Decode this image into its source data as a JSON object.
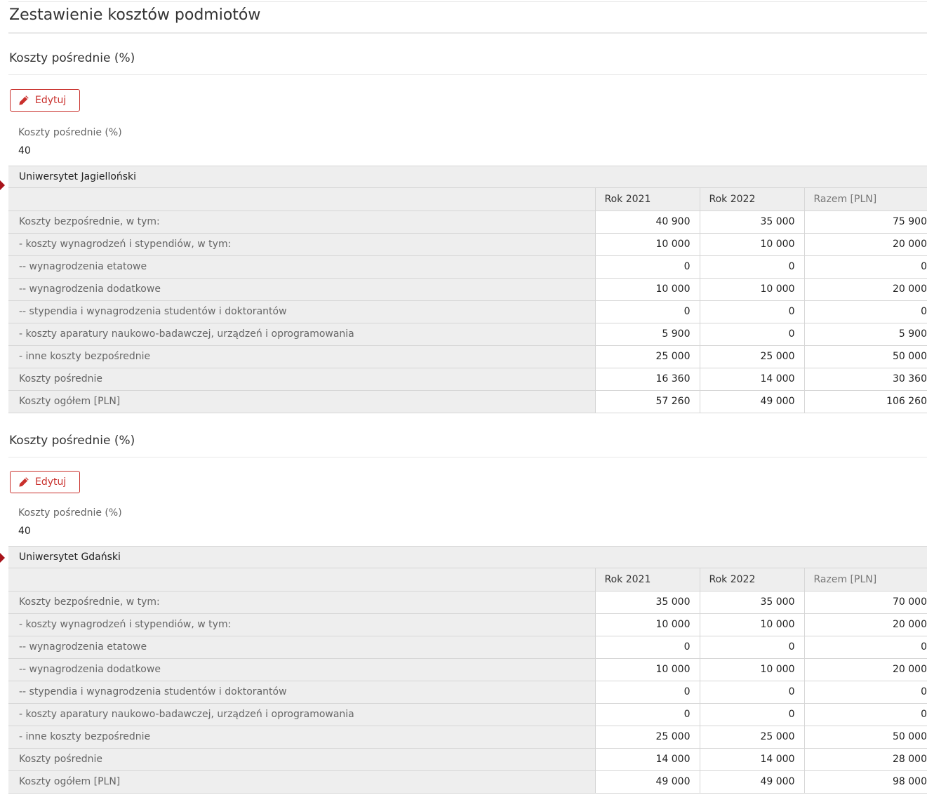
{
  "page": {
    "title": "Zestawienie kosztów podmiotów"
  },
  "sections": [
    {
      "title": "Koszty pośrednie (%)",
      "edit_label": "Edytuj",
      "field_label": "Koszty pośrednie (%)",
      "field_value": "40",
      "entity": {
        "name": "Uniwersytet Jagielloński",
        "columns": [
          "Rok 2021",
          "Rok 2022",
          "Razem [PLN]"
        ],
        "rows": [
          {
            "label": "Koszty bezpośrednie, w tym:",
            "values": [
              "40 900",
              "35 000",
              "75 900"
            ]
          },
          {
            "label": "- koszty wynagrodzeń i stypendiów, w tym:",
            "values": [
              "10 000",
              "10 000",
              "20 000"
            ]
          },
          {
            "label": "-- wynagrodzenia etatowe",
            "values": [
              "0",
              "0",
              "0"
            ]
          },
          {
            "label": "-- wynagrodzenia dodatkowe",
            "values": [
              "10 000",
              "10 000",
              "20 000"
            ]
          },
          {
            "label": "-- stypendia i wynagrodzenia studentów i doktorantów",
            "values": [
              "0",
              "0",
              "0"
            ]
          },
          {
            "label": "- koszty aparatury naukowo-badawczej, urządzeń i oprogramowania",
            "values": [
              "5 900",
              "0",
              "5 900"
            ]
          },
          {
            "label": "- inne koszty bezpośrednie",
            "values": [
              "25 000",
              "25 000",
              "50 000"
            ]
          },
          {
            "label": "Koszty pośrednie",
            "values": [
              "16 360",
              "14 000",
              "30 360"
            ]
          },
          {
            "label": "Koszty ogółem [PLN]",
            "values": [
              "57 260",
              "49 000",
              "106 260"
            ]
          }
        ]
      }
    },
    {
      "title": "Koszty pośrednie (%)",
      "edit_label": "Edytuj",
      "field_label": "Koszty pośrednie (%)",
      "field_value": "40",
      "entity": {
        "name": "Uniwersytet Gdański",
        "columns": [
          "Rok 2021",
          "Rok 2022",
          "Razem [PLN]"
        ],
        "rows": [
          {
            "label": "Koszty bezpośrednie, w tym:",
            "values": [
              "35 000",
              "35 000",
              "70 000"
            ]
          },
          {
            "label": "- koszty wynagrodzeń i stypendiów, w tym:",
            "values": [
              "10 000",
              "10 000",
              "20 000"
            ]
          },
          {
            "label": "-- wynagrodzenia etatowe",
            "values": [
              "0",
              "0",
              "0"
            ]
          },
          {
            "label": "-- wynagrodzenia dodatkowe",
            "values": [
              "10 000",
              "10 000",
              "20 000"
            ]
          },
          {
            "label": "-- stypendia i wynagrodzenia studentów i doktorantów",
            "values": [
              "0",
              "0",
              "0"
            ]
          },
          {
            "label": "- koszty aparatury naukowo-badawczej, urządzeń i oprogramowania",
            "values": [
              "0",
              "0",
              "0"
            ]
          },
          {
            "label": "- inne koszty bezpośrednie",
            "values": [
              "25 000",
              "25 000",
              "50 000"
            ]
          },
          {
            "label": "Koszty pośrednie",
            "values": [
              "14 000",
              "14 000",
              "28 000"
            ]
          },
          {
            "label": "Koszty ogółem [PLN]",
            "values": [
              "49 000",
              "49 000",
              "98 000"
            ]
          }
        ]
      }
    }
  ],
  "colors": {
    "accent": "#c9302c",
    "marker": "#a8131a",
    "header_bg": "#eeeeee",
    "border": "#d6d6d6"
  },
  "icons": {
    "edit": "pencil-icon"
  }
}
